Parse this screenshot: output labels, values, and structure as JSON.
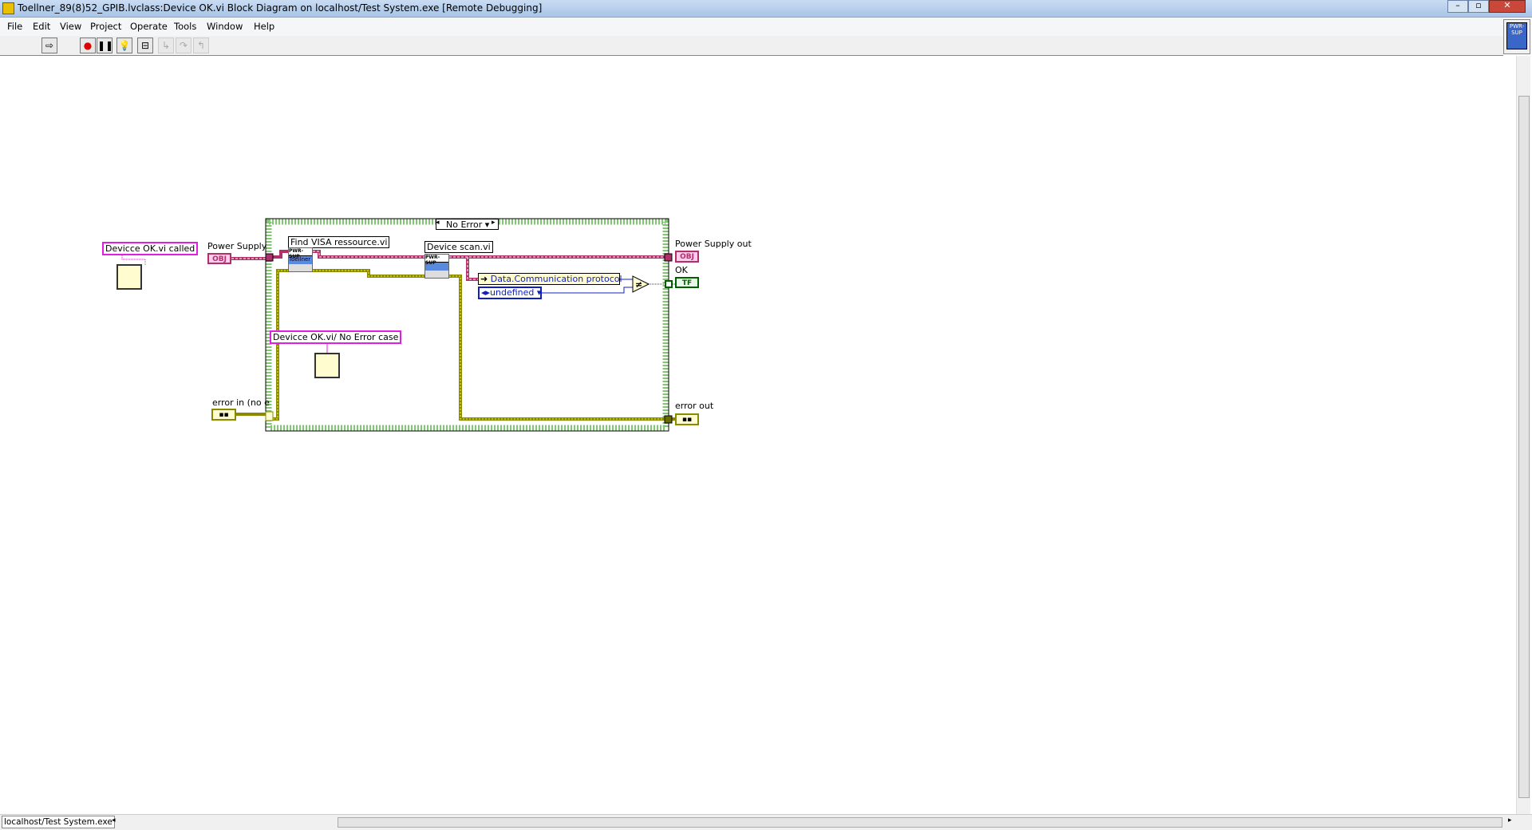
{
  "window": {
    "title": "Toellner_89(8)52_GPIB.lvclass:Device OK.vi Block Diagram on localhost/Test System.exe [Remote Debugging]"
  },
  "menu": [
    "File",
    "Edit",
    "View",
    "Project",
    "Operate",
    "Tools",
    "Window",
    "Help"
  ],
  "toolbar": {
    "icons": [
      "run-continuously-icon",
      "abort-icon",
      "pause-icon",
      "highlight-execution-icon",
      "retain-wire-values-icon",
      "step-into-icon",
      "step-over-icon",
      "step-out-icon"
    ]
  },
  "diagram": {
    "note_called": "Devicce OK.vi called",
    "note_case": "Devicce OK.vi/ No Error case",
    "power_supply_in": "Power Supply",
    "obj_tag": "OBJ",
    "error_in": "error in (no e",
    "case_selector": "No Error",
    "find_visa": "Find VISA ressource.vi",
    "device_scan": "Device scan.vi",
    "pwr_sup": "PWR-SUP",
    "toellner": "Toellner",
    "property": "Data.Communication protocol",
    "enum_value": "undefined",
    "power_supply_out": "Power Supply out",
    "ok": "OK",
    "tf_tag": "TF",
    "error_out": "error out"
  },
  "status": {
    "context": "localhost/Test System.exe"
  },
  "colors": {
    "class_wire": "#b0306a",
    "error_wire": "#8a8a00",
    "enum_wire": "#1020c0",
    "bool_wire": "#006000",
    "case_border": "#4a9a3a",
    "note_border": "#e020e0"
  }
}
